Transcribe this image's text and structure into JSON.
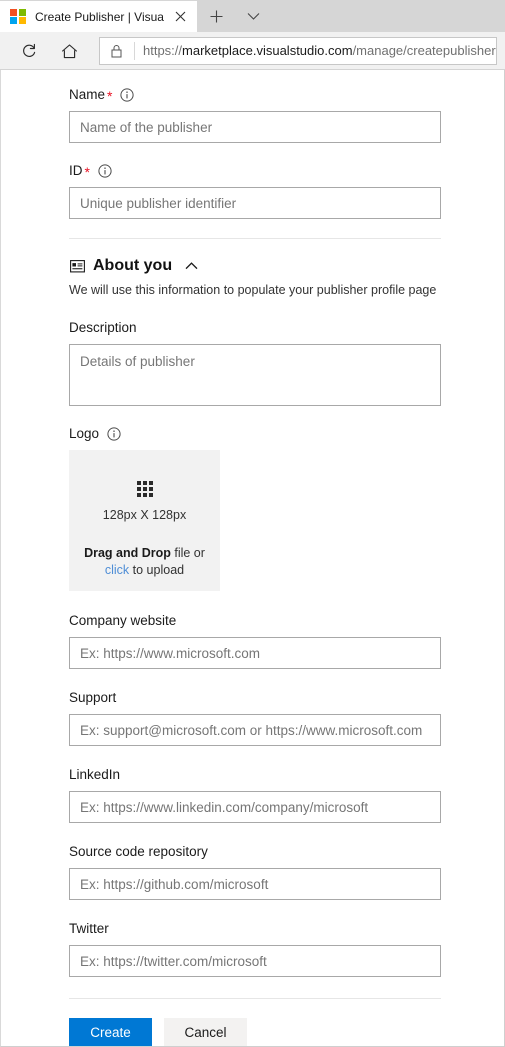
{
  "browser": {
    "tab": {
      "title": "Create Publisher | Visua",
      "favicon": "microsoft-logo-icon",
      "close_label": "✕"
    },
    "new_tab_label": "+",
    "tab_list_label": "⌄",
    "toolbar": {
      "refresh_label": "refresh-icon",
      "home_label": "home-icon",
      "lock_label": "lock-icon"
    },
    "address": {
      "scheme": "https://",
      "host": "marketplace.visualstudio.com",
      "path": "/manage/createpublisher"
    }
  },
  "form": {
    "name": {
      "label": "Name",
      "required_marker": "*",
      "placeholder": "Name of the publisher",
      "value": ""
    },
    "id": {
      "label": "ID",
      "required_marker": "*",
      "placeholder": "Unique publisher identifier",
      "value": ""
    },
    "about_section": {
      "icon": "contact-card-icon",
      "title": "About you",
      "chevron": "chevron-up-icon",
      "subtitle": "We will use this information to populate your publisher profile page"
    },
    "description": {
      "label": "Description",
      "placeholder": "Details of publisher",
      "value": ""
    },
    "logo": {
      "label": "Logo",
      "icon": "grid-icon",
      "dimensions": "128px X 128px",
      "cta_bold": "Drag and Drop",
      "cta_mid": " file or",
      "cta_link": "click",
      "cta_tail": " to upload"
    },
    "company_website": {
      "label": "Company website",
      "placeholder": "Ex: https://www.microsoft.com",
      "value": ""
    },
    "support": {
      "label": "Support",
      "placeholder": "Ex: support@microsoft.com or https://www.microsoft.com",
      "value": ""
    },
    "linkedin": {
      "label": "LinkedIn",
      "placeholder": "Ex: https://www.linkedin.com/company/microsoft",
      "value": ""
    },
    "source_code_repository": {
      "label": "Source code repository",
      "placeholder": "Ex: https://github.com/microsoft",
      "value": ""
    },
    "twitter": {
      "label": "Twitter",
      "placeholder": "Ex: https://twitter.com/microsoft",
      "value": ""
    },
    "actions": {
      "create_label": "Create",
      "cancel_label": "Cancel"
    }
  },
  "colors": {
    "accent_blue": "#0078d4",
    "required_red": "#e81123",
    "link_blue": "#4f8ed6",
    "dropzone_bg": "#f2f2f2"
  }
}
